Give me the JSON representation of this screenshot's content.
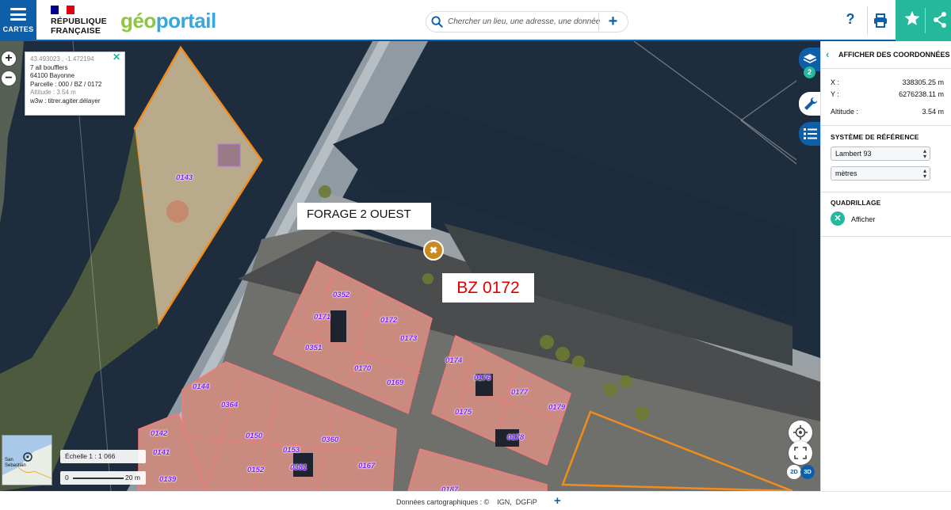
{
  "header": {
    "menu_label": "CARTES",
    "republique_line1": "RÉPUBLIQUE",
    "republique_line2": "FRANÇAISE",
    "logo_geo": "géo",
    "logo_portail": "portail",
    "search_placeholder": "Chercher un lieu, une adresse, une donnée",
    "search_add": "+",
    "help": "?"
  },
  "popup": {
    "coords": "43.493023 , -1.472194",
    "address": "7 all boufflers",
    "city": "64100 Bayonne",
    "parcelle": "Parcelle : 000 / BZ / 0172",
    "altitude": "Altitude : 3.54 m",
    "w3w": "w3w : titrer.agiter.délayer",
    "close": "✕"
  },
  "map": {
    "zoom_in": "+",
    "zoom_out": "−",
    "annotations": {
      "forage": "FORAGE 2 OUEST",
      "bz": "BZ 0172"
    },
    "marker_symbol": "✖",
    "parcels": [
      "0143",
      "0352",
      "0171",
      "0172",
      "0173",
      "0351",
      "0170",
      "0169",
      "0174",
      "0176",
      "0177",
      "0175",
      "0179",
      "0178",
      "0144",
      "0364",
      "0142",
      "0150",
      "0360",
      "0141",
      "0153",
      "0381",
      "0167",
      "0152",
      "0139",
      "0187",
      "0380",
      "0186"
    ],
    "layers_badge": "2",
    "minimap_label": "San\nSebastián",
    "scale_text": "Échelle 1 : 1 066",
    "scale_bar_label": "20 m",
    "scale_bar_zero": "0",
    "btn_2d": "2D",
    "btn_3d": "3D"
  },
  "panel": {
    "title": "AFFICHER DES COORDONNÉES",
    "back": "‹",
    "x_label": "X :",
    "x_value": "338305.25 m",
    "y_label": "Y :",
    "y_value": "6276238.11 m",
    "alt_label": "Altitude :",
    "alt_value": "3.54 m",
    "ref_title": "SYSTÈME DE RÉFÉRENCE",
    "ref_system": "Lambert 93",
    "ref_unit": "mètres",
    "grid_title": "QUADRILLAGE",
    "grid_toggle": "Afficher",
    "grid_icon": "✕"
  },
  "footer": {
    "credit": "Données cartographiques : ©    IGN,  DGFiP",
    "more": "+"
  },
  "colors": {
    "brand_blue": "#0f5fa8",
    "accent_green": "#24b89c",
    "parcel_orange": "#f28c1b",
    "parcel_label": "#7a1cff",
    "annotation_red": "#e00000"
  }
}
